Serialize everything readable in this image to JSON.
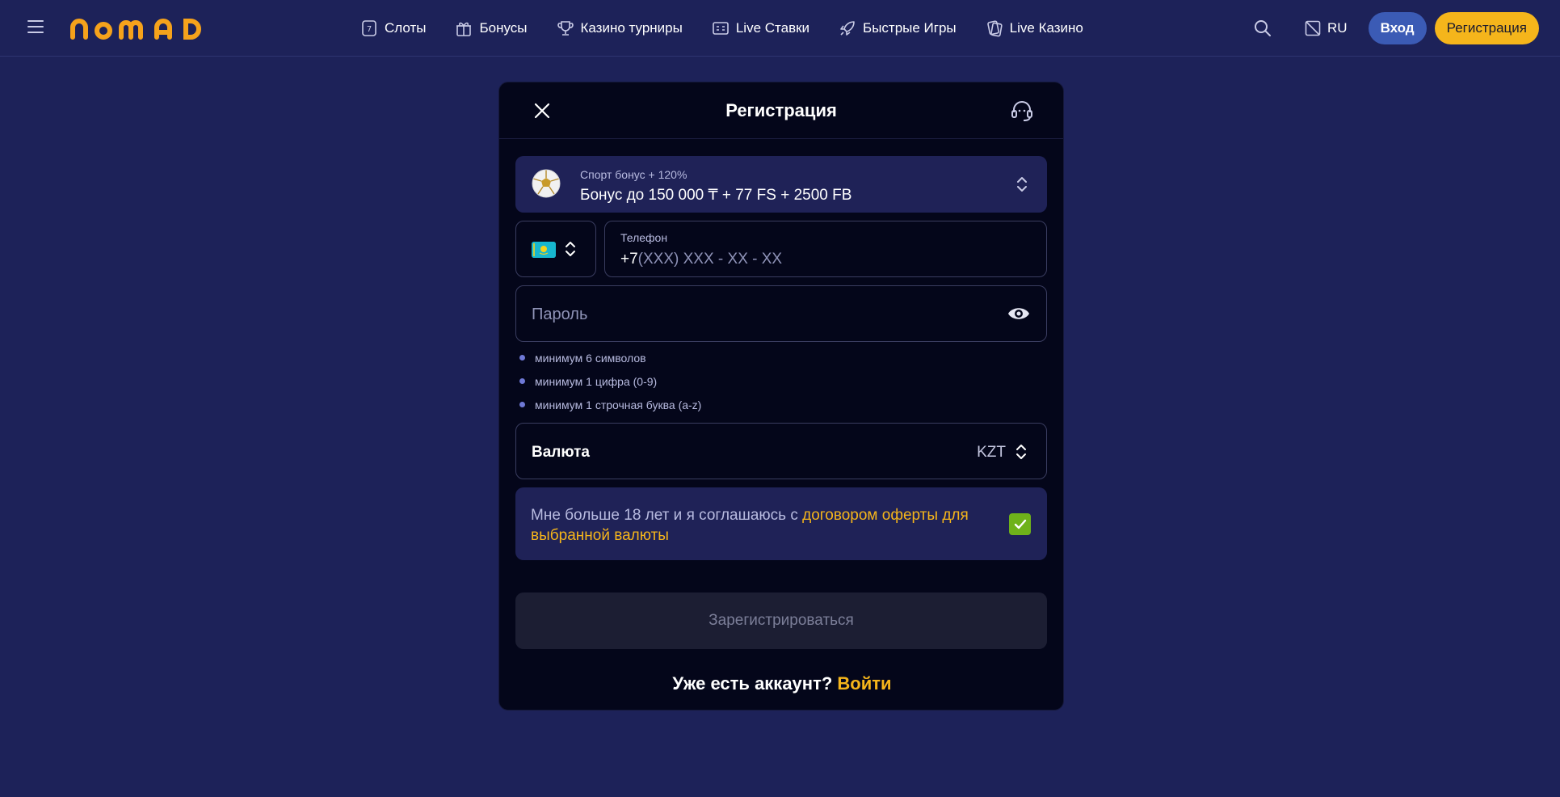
{
  "header": {
    "logo_text": "NOMAD",
    "nav": [
      {
        "label": "Слоты",
        "icon": "slot-icon"
      },
      {
        "label": "Бонусы",
        "icon": "gift-icon"
      },
      {
        "label": "Казино турниры",
        "icon": "trophy-icon"
      },
      {
        "label": "Live Ставки",
        "icon": "scoreboard-icon"
      },
      {
        "label": "Быстрые Игры",
        "icon": "rocket-icon"
      },
      {
        "label": "Live Казино",
        "icon": "cards-icon"
      }
    ],
    "language": "RU",
    "login_label": "Вход",
    "register_label": "Регистрация"
  },
  "modal": {
    "title": "Регистрация",
    "bonus": {
      "subtitle": "Спорт бонус + 120%",
      "title": "Бонус до 150 000 ₸ + 77 FS + 2500 FB"
    },
    "phone": {
      "label": "Телефон",
      "prefix": "+7",
      "placeholder": "(XXX) XXX - XX - XX"
    },
    "password": {
      "placeholder": "Пароль"
    },
    "password_rules": [
      "минимум 6 символов",
      "минимум 1 цифра (0-9)",
      "минимум 1 строчная буква (a-z)"
    ],
    "currency": {
      "label": "Валюта",
      "value": "KZT"
    },
    "agreement": {
      "text": "Мне больше 18 лет и я соглашаюсь с ",
      "link": "договором оферты для выбранной валюты",
      "checked": true
    },
    "submit_label": "Зарегистрироваться",
    "footer": {
      "text": "Уже есть аккаунт? ",
      "link": "Войти"
    }
  },
  "colors": {
    "background": "#1d2259",
    "modal": "#04061a",
    "accent": "#f5b51b",
    "login_button": "#3b5bb5",
    "checkbox": "#6fb21a"
  }
}
